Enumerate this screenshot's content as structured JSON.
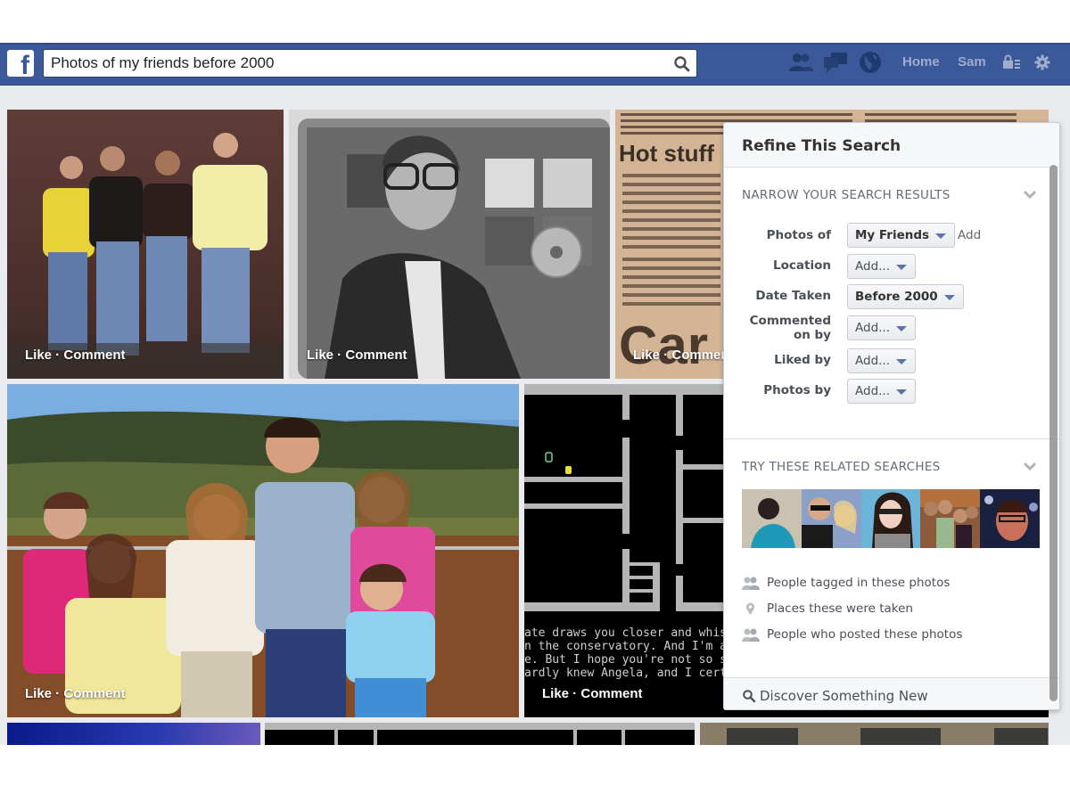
{
  "topbar": {
    "logo_letter": "f",
    "search_value": "Photos of my friends before 2000",
    "nav_links": [
      "Home",
      "Sam"
    ],
    "icons": [
      "friend-requests-icon",
      "messages-icon",
      "notifications-globe-icon",
      "privacy-shortcuts-icon",
      "settings-gear-icon"
    ],
    "brand_color": "#3b5998"
  },
  "photos": [
    {
      "subject": "Four teenage boys posing against a wall",
      "caption": {
        "like": "Like",
        "sep": " · ",
        "comment": "Comment"
      }
    },
    {
      "subject": "Man in glasses holding a compact disc (black and white)",
      "caption": {
        "like": "Like",
        "sep": " · ",
        "comment": "Comment"
      }
    },
    {
      "subject": "Newspaper clipping 'Hot stuff'",
      "headline": "Hot stuff",
      "caption": {
        "like": "Like",
        "sep": " · ",
        "comment": "Comment"
      }
    },
    {
      "subject": "Family posing in front of autumn hills",
      "caption": {
        "like": "Like",
        "sep": " · ",
        "comment": "Comment"
      }
    },
    {
      "subject": "Retro text adventure game screen",
      "game_text": [
        "ate draws you closer and whisp",
        "n the conservatory.  And I'm a",
        "e.  But I hope you're not so s",
        "ardly knew Angela, and I certa"
      ],
      "caption": {
        "like": "Like",
        "sep": " · ",
        "comment": "Comment"
      }
    }
  ],
  "refine": {
    "title": "Refine This Search",
    "narrow_title": "NARROW YOUR SEARCH RESULTS",
    "filters": [
      {
        "label": "Photos of",
        "value": "My Friends",
        "selected": true,
        "extra": "Add"
      },
      {
        "label": "Location",
        "value": "Add...",
        "selected": false
      },
      {
        "label": "Date Taken",
        "value": "Before 2000",
        "selected": true
      },
      {
        "label": "Commented on by",
        "label_line1": "Commented",
        "label_line2": "on by",
        "value": "Add...",
        "selected": false
      },
      {
        "label": "Liked by",
        "value": "Add...",
        "selected": false
      },
      {
        "label": "Photos by",
        "value": "Add...",
        "selected": false
      }
    ],
    "related_title": "TRY THESE RELATED SEARCHES",
    "related": [
      {
        "icon": "people-icon",
        "label": "People tagged in these photos"
      },
      {
        "icon": "map-pin-icon",
        "label": "Places these were taken"
      },
      {
        "icon": "people-icon",
        "label": "People who posted these photos"
      }
    ],
    "discover": "Discover Something New"
  }
}
